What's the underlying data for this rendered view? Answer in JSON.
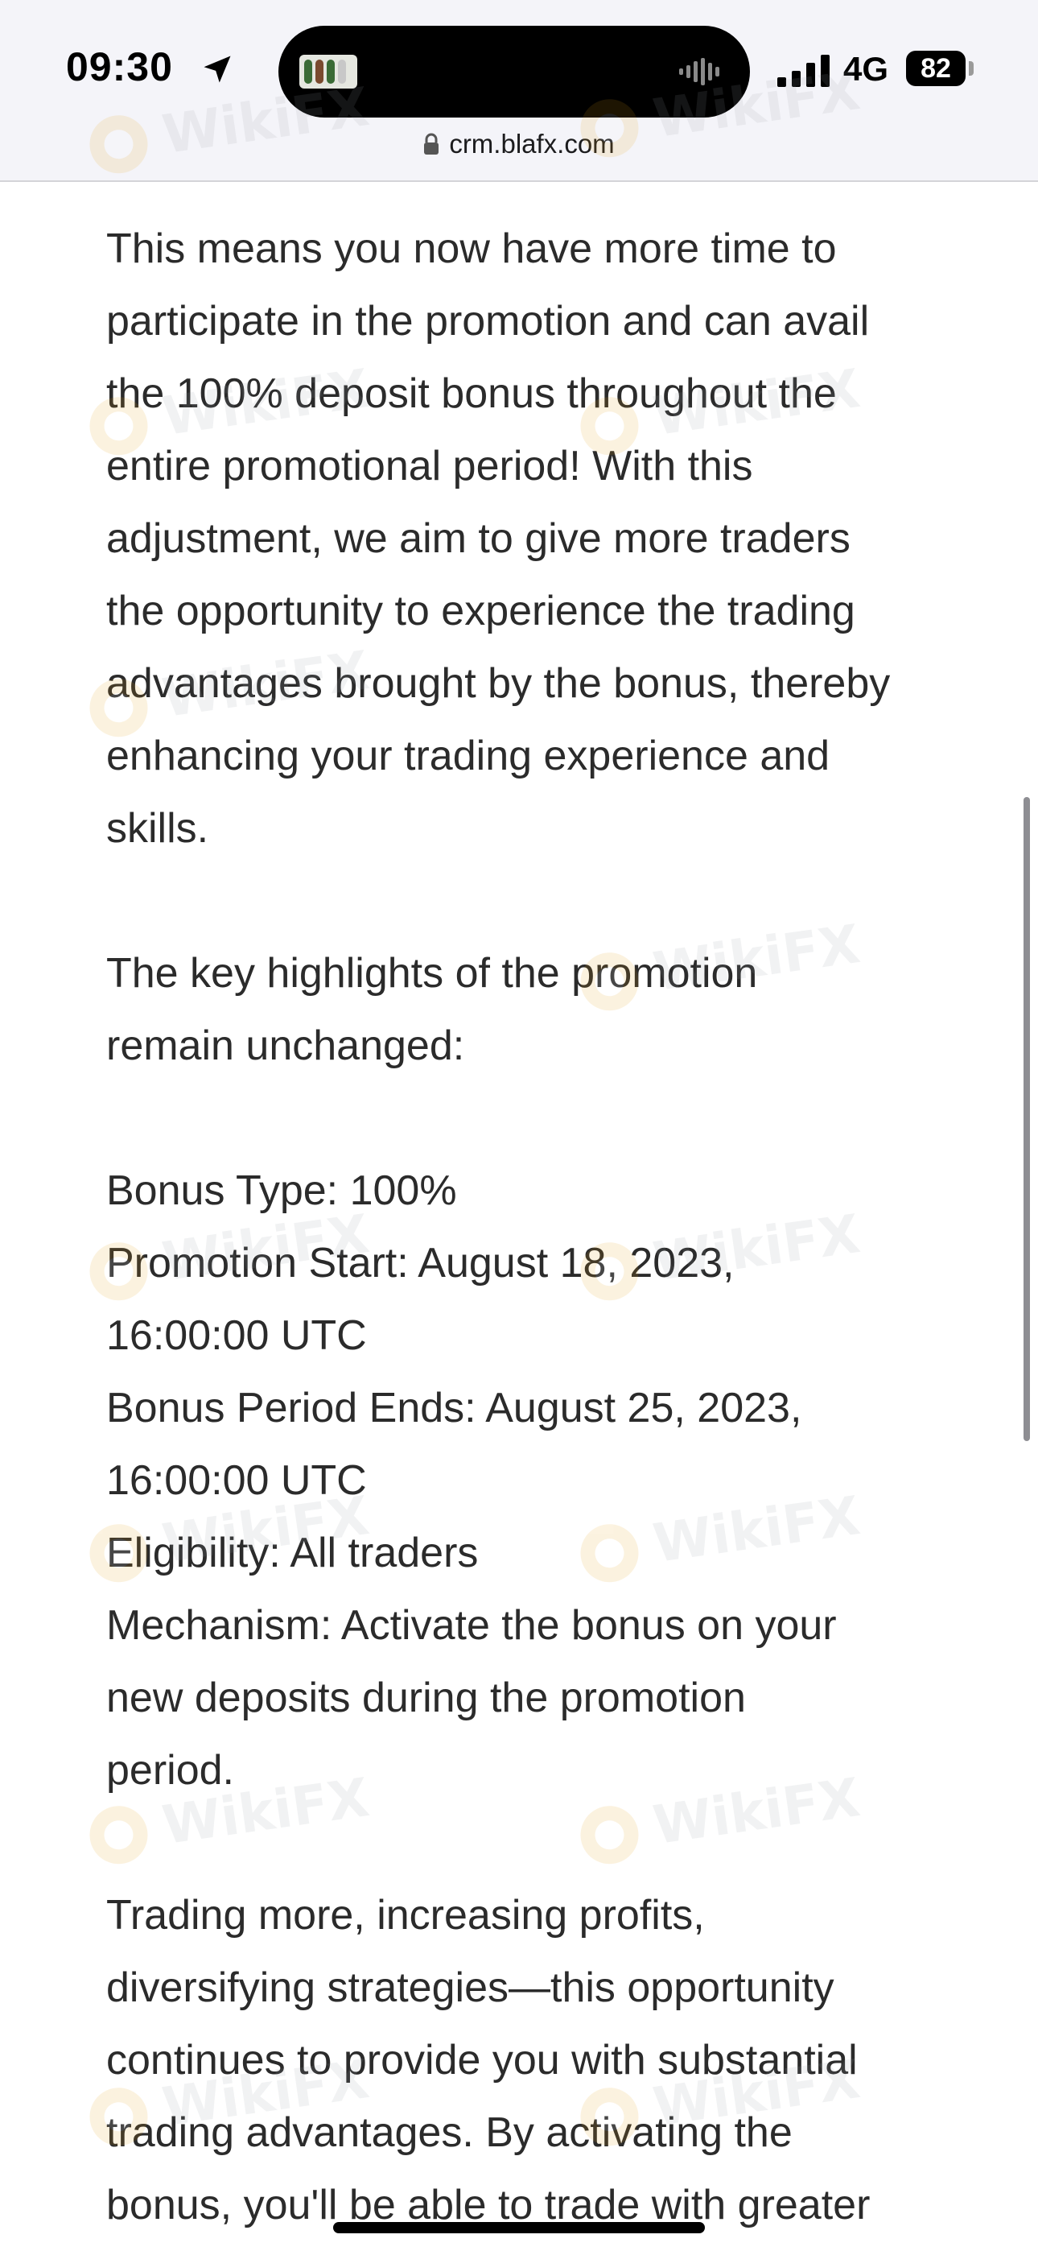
{
  "status_bar": {
    "time": "09:30",
    "network": "4G",
    "battery": "82"
  },
  "browser": {
    "url": "crm.blafx.com"
  },
  "watermark": {
    "text": "WikiFX",
    "color": "#e8a214"
  },
  "article": {
    "para1": [
      "This means you now have more time to",
      "participate in the promotion and can avail",
      "the 100% deposit bonus throughout the",
      "entire promotional period! With this",
      "adjustment, we aim to give more traders",
      "the opportunity to experience the trading",
      "advantages brought by the bonus, thereby",
      "enhancing your trading experience and",
      "skills."
    ],
    "para2": [
      "The key highlights of the promotion",
      "remain unchanged:"
    ],
    "details": [
      "Bonus Type: 100%",
      "Promotion Start: August 18, 2023,",
      "16:00:00 UTC",
      "Bonus Period Ends: August 25, 2023,",
      "16:00:00 UTC",
      "Eligibility: All traders",
      "Mechanism: Activate the bonus on your",
      "new deposits during the promotion",
      "period."
    ],
    "para3": [
      "Trading more, increasing profits,",
      "diversifying strategies—this opportunity",
      "continues to provide you with substantial",
      "trading advantages. By activating the",
      "bonus, you'll be able to trade with greater"
    ]
  }
}
